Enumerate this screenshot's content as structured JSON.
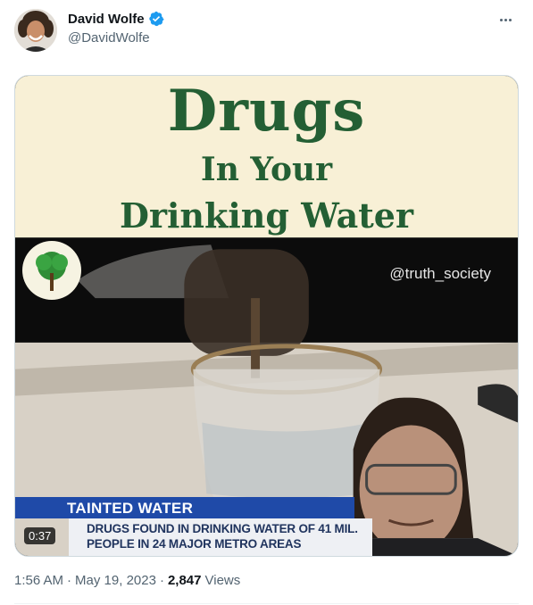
{
  "author": {
    "name": "David Wolfe",
    "handle": "@DavidWolfe",
    "verified": true,
    "verified_color": "#1d9bf0"
  },
  "media": {
    "title_line1": "Drugs",
    "title_line2": "In Your",
    "title_line3": "Drinking Water",
    "watermark": "@truth_society",
    "lower_third_top": "TAINTED WATER",
    "lower_third_bottom": "DRUGS FOUND IN DRINKING WATER OF 41 MIL. PEOPLE IN 24 MAJOR METRO AREAS",
    "duration": "0:37",
    "title_color": "#245f34",
    "banner_color": "#1f4aa8"
  },
  "meta": {
    "time": "1:56 AM",
    "separator": "·",
    "date": "May 19, 2023",
    "views_count": "2,847",
    "views_label": "Views"
  },
  "icons": [
    "verified-badge-icon",
    "more-options-icon",
    "avatar"
  ]
}
